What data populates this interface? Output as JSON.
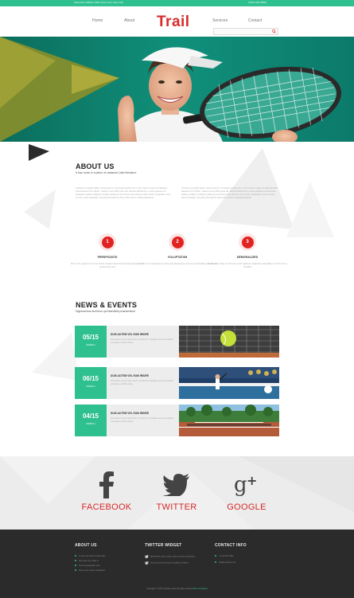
{
  "topbar": {
    "address": "Subscribe Addition Office Sixty Four, New York",
    "phone": "0 800 1234 8558"
  },
  "nav": {
    "items": [
      "Home",
      "About",
      "Services",
      "Contact"
    ],
    "logo": "Trail",
    "search_placeholder": "Enter keyword"
  },
  "about": {
    "title": "ABOUT US",
    "subtitle": "It has roots in a piece of classical Latin literature",
    "left_para": "Contrary to popular belief, Lorem Ipsum is not simply random text. It has roots in a piece of classical Latin literature from 45 BC, making it over 2000 years old. Richard McClintock, a Latin professor at Hampden-Sydney College in Virginia, looked up one of the more obscure Latin words, consectetur, from a Lorem Ipsum passage, and going through the cites of the word in classical literature.",
    "right_para": "Contrary to popular belief, Lorem Ipsum is not simply random text. It has roots in a piece of classical Latin literature from 45 BC, making it over 2000 years old. Richard McClintock, a Latin professor at Hampden-Sydney College in Virginia, looked up one of the more obscure Latin words, consectetur, from a Lorem Ipsum passage, and going through the cites of the word in classical literature."
  },
  "features": [
    {
      "num": "1",
      "title": "PERSPICIATIS",
      "desc": "But I must explain to you how all this mistaken idea of denouncing pleasure and praising pain was"
    },
    {
      "num": "2",
      "title": "VOLUPTATUM",
      "desc": "At vero eos et accusamus et iusto odio dignissimos ducimus qui blanditiis praesentium"
    },
    {
      "num": "3",
      "title": "DEMORALIZED",
      "desc": "On the other hand, we denounce with righteous indignation and dislike men who are so beguiled"
    }
  ],
  "news": {
    "title": "NEWS & EVENTS",
    "subtitle": "Dignissimos ducimus qui blanditiis praesentium",
    "items": [
      {
        "date": "05/15",
        "month": "MARCH",
        "title": "DUIS AUTEM VEL EUM IRIURE",
        "desc": "Duis autem vel eum iriure dolor in hendrerit in vulputate velit esse molestie consequat, vel illum dolore"
      },
      {
        "date": "06/15",
        "month": "MARCH",
        "title": "DUIS AUTEM VEL EUM IRIURE",
        "desc": "Duis autem vel eum iriure dolor in hendrerit in vulputate velit esse molestie consequat, vel illum dolore"
      },
      {
        "date": "04/15",
        "month": "MARCH",
        "title": "DUIS AUTEM VEL EUM IRIURE",
        "desc": "Duis autem vel eum iriure dolor in hendrerit in vulputate velit esse molestie consequat, vel illum dolore"
      }
    ]
  },
  "social": [
    {
      "label": "FACEBOOK",
      "icon": "facebook-icon"
    },
    {
      "label": "TWITTER",
      "icon": "twitter-icon"
    },
    {
      "label": "GOOGLE",
      "icon": "google-plus-icon"
    }
  ],
  "footer": {
    "about_title": "ABOUT US",
    "about_items": [
      "Ut enim ad minim veniam quis",
      "Duis aute irure dolor in",
      "Sed ut perspiciatis unde",
      "Nemo enim ipsam voluptatem"
    ],
    "twitter_title": "TWITTER WIDGET",
    "twitter_items": [
      "@example Lorem ipsum dolor sit amet consectetur",
      "Sed do eiusmod tempor incididunt ut labore"
    ],
    "contact_title": "CONTACT INFO",
    "contact_items": [
      "+1 234 567 8901",
      "info@example.com"
    ],
    "copyright": "Copyright © 2015 Company name All rights reserved",
    "copyright_link": "More Templates"
  },
  "colors": {
    "accent_green": "#2ec08e",
    "accent_red": "#d92b2b",
    "footer_bg": "#2b2b2b"
  }
}
